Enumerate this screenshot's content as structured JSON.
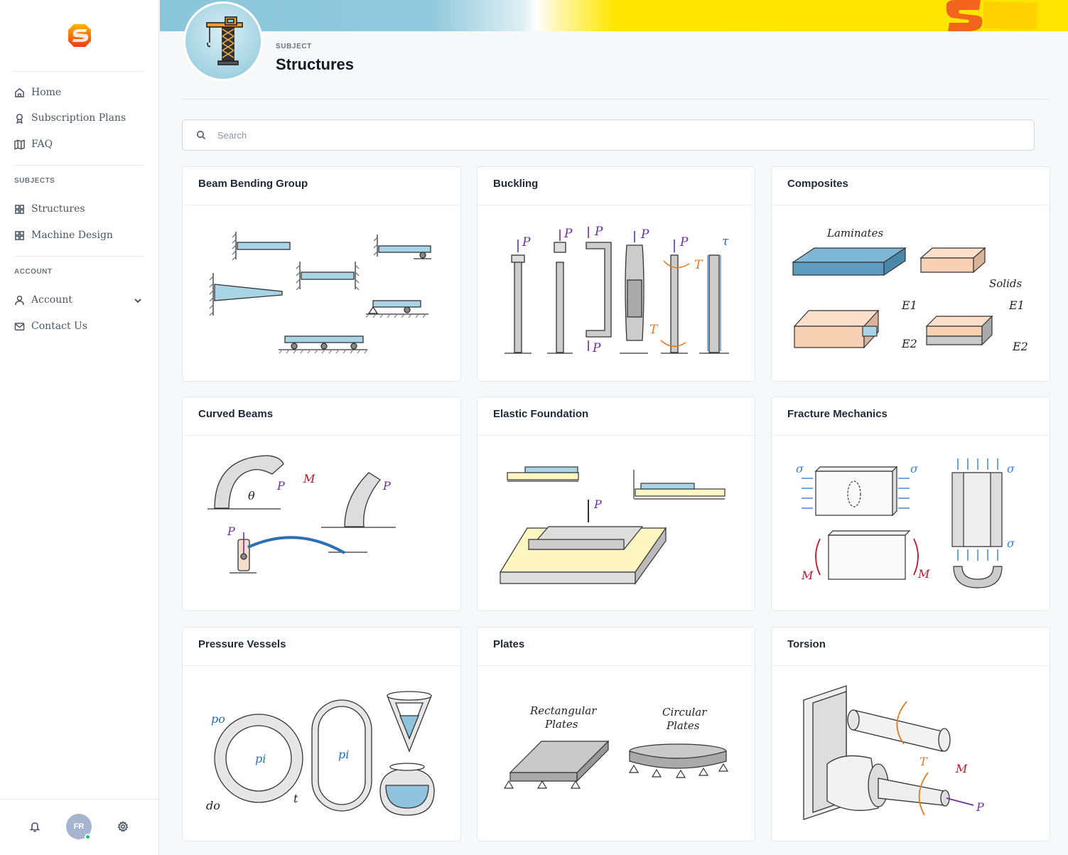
{
  "sidebar": {
    "nav": [
      {
        "label": "Home",
        "icon": "home-icon"
      },
      {
        "label": "Subscription  Plans",
        "icon": "award-icon"
      },
      {
        "label": "FAQ",
        "icon": "map-icon"
      }
    ],
    "subjects_label": "SUBJECTS",
    "subjects": [
      {
        "label": "Structures",
        "icon": "grid-icon"
      },
      {
        "label": "Machine  Design",
        "icon": "grid-icon"
      }
    ],
    "account_label": "ACCOUNT",
    "account": [
      {
        "label": "Account",
        "icon": "user-icon"
      },
      {
        "label": "Contact  Us",
        "icon": "mail-icon"
      }
    ],
    "footer": {
      "avatar_initials": "FR",
      "status": "online"
    }
  },
  "header": {
    "subject_label": "SUBJECT",
    "title": "Structures"
  },
  "search": {
    "placeholder": "Search",
    "value": ""
  },
  "cards": [
    {
      "title": "Beam Bending Group",
      "image": "beam-bending-illustration"
    },
    {
      "title": "Buckling",
      "image": "buckling-illustration"
    },
    {
      "title": "Composites",
      "image": "composites-illustration"
    },
    {
      "title": "Curved Beams",
      "image": "curved-beams-illustration"
    },
    {
      "title": "Elastic Foundation",
      "image": "elastic-foundation-illustration"
    },
    {
      "title": "Fracture Mechanics",
      "image": "fracture-mechanics-illustration"
    },
    {
      "title": "Pressure Vessels",
      "image": "pressure-vessels-illustration"
    },
    {
      "title": "Plates",
      "image": "plates-illustration"
    },
    {
      "title": "Torsion",
      "image": "torsion-illustration"
    }
  ],
  "illustration_labels": {
    "load_p": "P",
    "torque_t": "T",
    "shear_tau": "τ",
    "moment_m": "M",
    "angle_theta": "θ",
    "stress_sigma": "σ",
    "laminates": "Laminates",
    "solids": "Solids",
    "e1": "E1",
    "e2": "E2",
    "p_outer": "po",
    "p_inner": "pi",
    "d_outer": "do",
    "thickness_t": "t",
    "rect_plates_1": "Rectangular",
    "rect_plates_2": "Plates",
    "circ_plates_1": "Circular",
    "circ_plates_2": "Plates"
  },
  "colors": {
    "accent_blue": "#8cc7da",
    "beam_fill": "#a8d4e6",
    "load_purple": "#6b2fa0",
    "torque_orange": "#e07b22",
    "moment_red": "#c0152a",
    "stress_blue": "#3b7fd0",
    "banner_yellow": "#ffe600",
    "logo_red": "#f04e23"
  }
}
